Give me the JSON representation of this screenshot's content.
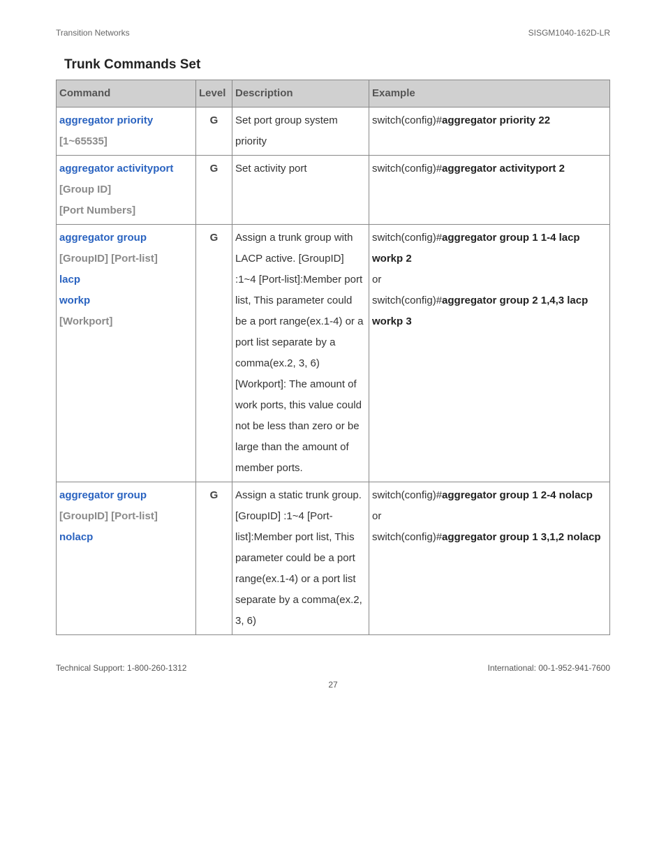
{
  "header": {
    "left": "Transition Networks",
    "right": "SISGM1040-162D-LR"
  },
  "section_title": "Trunk Commands Set",
  "columns": {
    "command": "Command",
    "level": "Level",
    "description": "Description",
    "example": "Example"
  },
  "rows": [
    {
      "command": [
        {
          "text": "aggregator priority",
          "cls": "cmd-blue"
        },
        {
          "text": "[1~65535]",
          "cls": "cmd-gray"
        }
      ],
      "level": "G",
      "description": "Set port group system priority",
      "example": [
        {
          "pre": "switch(config)#",
          "bold": "aggregator priority 22"
        }
      ]
    },
    {
      "command": [
        {
          "text": "aggregator activityport",
          "cls": "cmd-blue"
        },
        {
          "text": "[Group ID]",
          "cls": "cmd-gray"
        },
        {
          "text": "[Port Numbers]",
          "cls": "cmd-gray"
        }
      ],
      "level": "G",
      "description": "Set activity port",
      "example": [
        {
          "pre": "switch(config)#",
          "bold": "aggregator activityport 2"
        }
      ]
    },
    {
      "command": [
        {
          "text": "aggregator group",
          "cls": "cmd-blue"
        },
        {
          "text": "[GroupID] [Port-list]",
          "cls": "cmd-gray"
        },
        {
          "text": "lacp",
          "cls": "cmd-blue"
        },
        {
          "text": "workp",
          "cls": "cmd-blue"
        },
        {
          "text": "[Workport]",
          "cls": "cmd-gray"
        }
      ],
      "level": "G",
      "description": "Assign a trunk group with LACP active. [GroupID] :1~4 [Port-list]:Member port list, This parameter could be a port range(ex.1-4) or a port list separate by a comma(ex.2, 3, 6) [Workport]: The amount of work ports, this value could not be less than zero or be large than the amount of member ports.",
      "example": [
        {
          "pre": "switch(config)#",
          "bold": "aggregator group 1 1-4 lacp workp 2"
        },
        {
          "pre": "or",
          "bold": ""
        },
        {
          "pre": "switch(config)#",
          "bold": "aggregator group 2 1,4,3 lacp workp 3"
        }
      ]
    },
    {
      "command": [
        {
          "text": "aggregator group",
          "cls": "cmd-blue"
        },
        {
          "text": "[GroupID] [Port-list]",
          "cls": "cmd-gray"
        },
        {
          "text": "nolacp",
          "cls": "cmd-blue"
        }
      ],
      "level": "G",
      "description": "Assign a static trunk group. [GroupID] :1~4 [Port-list]:Member port list, This parameter could be a port range(ex.1-4) or a port list separate by a comma(ex.2, 3, 6)",
      "example": [
        {
          "pre": "switch(config)#",
          "bold": "aggregator group 1 2-4 nolacp"
        },
        {
          "pre": "or",
          "bold": ""
        },
        {
          "pre": "switch(config)#",
          "bold": "aggregator group 1 3,1,2 nolacp"
        }
      ]
    }
  ],
  "footer": {
    "left": "Technical Support: 1-800-260-1312",
    "right": "International: 00-1-952-941-7600"
  },
  "page_number": "27"
}
